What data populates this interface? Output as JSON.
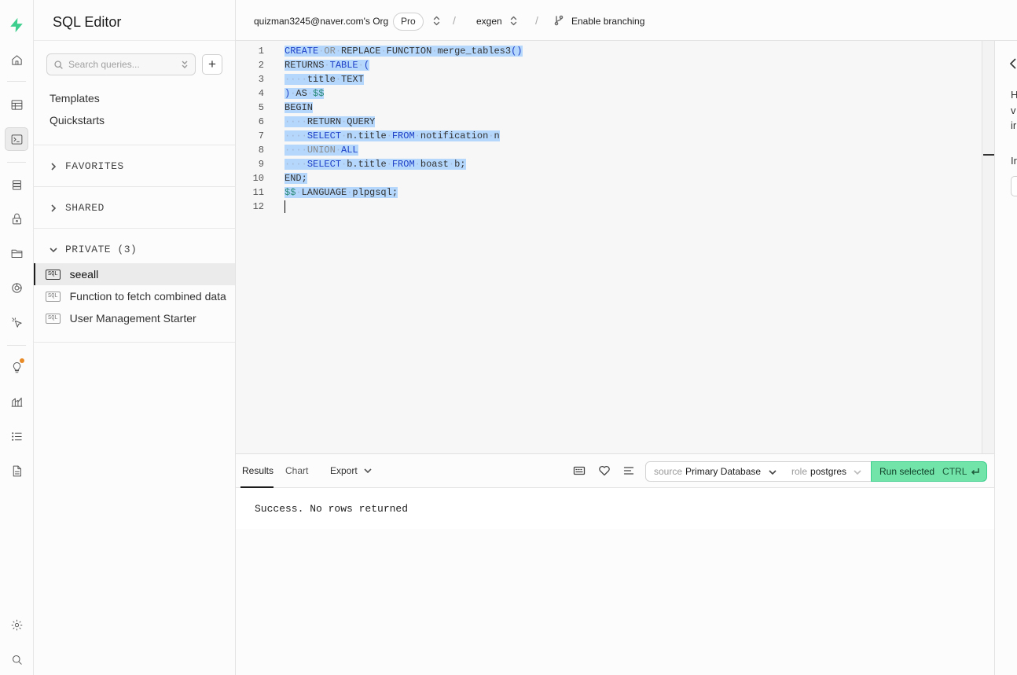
{
  "sidebar": {
    "title": "SQL Editor",
    "search_placeholder": "Search queries...",
    "links": [
      "Templates",
      "Quickstarts"
    ],
    "sections": {
      "favorites": "FAVORITES",
      "shared": "SHARED",
      "private": "PRIVATE (3)"
    },
    "queries": [
      {
        "badge": "SQL",
        "label": "seeall",
        "active": true
      },
      {
        "badge": "SQL",
        "label": "Function to fetch combined data",
        "active": false
      },
      {
        "badge": "SQL",
        "label": "User Management Starter",
        "active": false
      }
    ]
  },
  "topbar": {
    "org": "quizman3245@naver.com's Org",
    "plan": "Pro",
    "project": "exgen",
    "branching": "Enable branching"
  },
  "editor": {
    "line_numbers": [
      "1",
      "2",
      "3",
      "4",
      "5",
      "6",
      "7",
      "8",
      "9",
      "10",
      "11",
      "12"
    ],
    "lines": [
      "CREATE OR REPLACE FUNCTION merge_tables3()",
      "RETURNS TABLE (",
      "    title TEXT",
      ") AS $$",
      "BEGIN",
      "    RETURN QUERY",
      "    SELECT n.title FROM notification n",
      "    UNION ALL",
      "    SELECT b.title FROM boast b;",
      "END;",
      "$$ LANGUAGE plpgsql;",
      ""
    ]
  },
  "results": {
    "tabs": [
      "Results",
      "Chart"
    ],
    "export_label": "Export",
    "source_label": "source",
    "source_value": "Primary Database",
    "role_label": "role",
    "role_value": "postgres",
    "run_label": "Run selected",
    "run_shortcut": "CTRL",
    "message": "Success. No rows returned"
  },
  "right_panel": {
    "lines": [
      "H",
      "v",
      "ir",
      "Ir"
    ]
  },
  "colors": {
    "brand": "#3ecf8e",
    "run_button": "#72e3a9",
    "selection": "#b5d7fb",
    "keyword": "#1e40c8",
    "notice_dot": "#e88a26"
  }
}
